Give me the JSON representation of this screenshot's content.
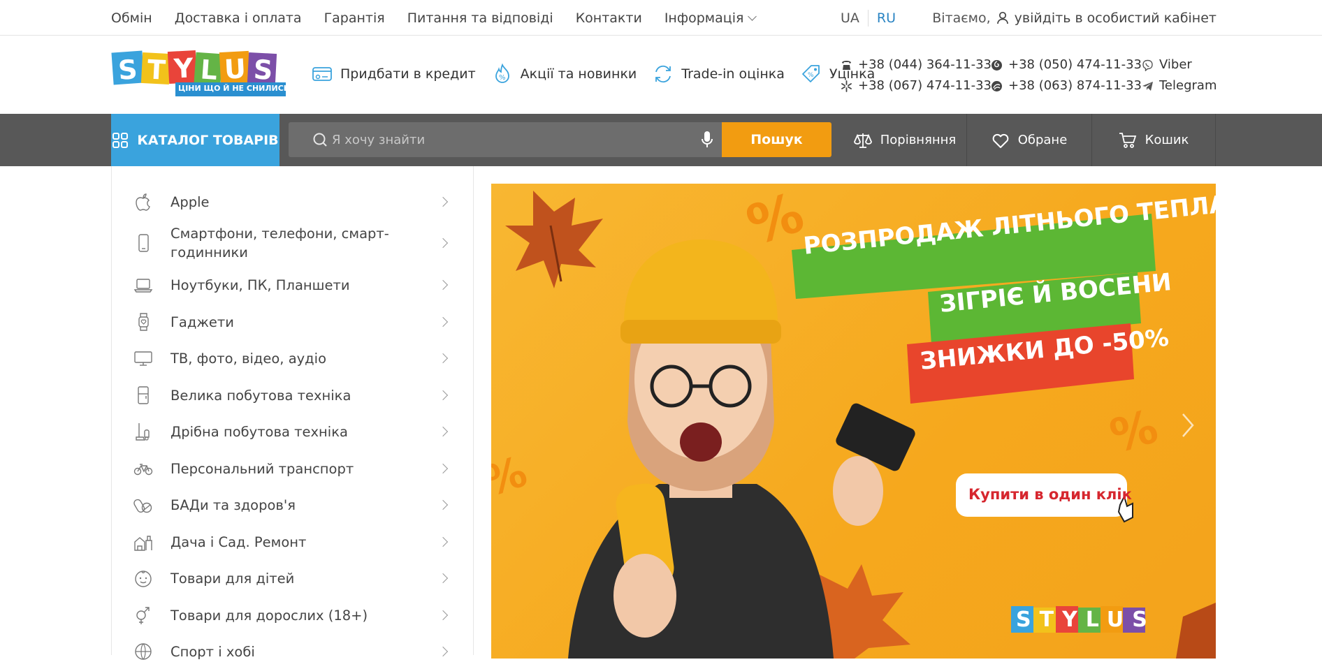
{
  "top_nav": {
    "links": [
      "Обмін",
      "Доставка і оплата",
      "Гарантія",
      "Питання та відповіді",
      "Контакти",
      "Інформація"
    ]
  },
  "languages": {
    "ua": "UA",
    "ru": "RU",
    "active": "UA"
  },
  "account": {
    "greeting": "Вітаємо,",
    "login_link": "увійдіть в особистий кабінет"
  },
  "logo": {
    "text": "STYLUS",
    "slogan": "ЦІНИ ЩО Й НЕ СНИЛИСЬ"
  },
  "promos": [
    {
      "label": "Придбати в кредит",
      "icon": "credit-card-icon"
    },
    {
      "label": "Акції та новинки",
      "icon": "fire-percent-icon"
    },
    {
      "label": "Trade-in оцінка",
      "icon": "exchange-icon"
    },
    {
      "label": "Уцінка",
      "icon": "price-tag-icon"
    }
  ],
  "phones": [
    {
      "number": "+38 (044) 364-11-33",
      "icon": "phone-icon"
    },
    {
      "number": "+38 (067) 474-11-33",
      "icon": "kyivstar-icon"
    },
    {
      "number": "+38 (050) 474-11-33",
      "icon": "vodafone-icon"
    },
    {
      "number": "+38 (063) 874-11-33",
      "icon": "lifecell-icon"
    }
  ],
  "messengers": [
    {
      "label": "Viber",
      "icon": "viber-icon"
    },
    {
      "label": "Telegram",
      "icon": "telegram-icon"
    }
  ],
  "toolbar": {
    "catalog_label": "КАТАЛОГ ТОВАРІВ",
    "search_placeholder": "Я хочу знайти",
    "search_button": "Пошук",
    "compare_label": "Порівняння",
    "favorites_label": "Обране",
    "cart_label": "Кошик"
  },
  "categories": [
    {
      "label": "Apple",
      "icon": "apple-icon"
    },
    {
      "label": "Смартфони, телефони, смарт-годинники",
      "icon": "smartphone-icon"
    },
    {
      "label": "Ноутбуки, ПК, Планшети",
      "icon": "laptop-icon"
    },
    {
      "label": "Гаджети",
      "icon": "smartwatch-icon"
    },
    {
      "label": "ТВ, фото, відео, аудіо",
      "icon": "tv-icon"
    },
    {
      "label": "Велика побутова техніка",
      "icon": "fridge-icon"
    },
    {
      "label": "Дрібна побутова техніка",
      "icon": "vacuum-icon"
    },
    {
      "label": "Персональний транспорт",
      "icon": "bicycle-icon"
    },
    {
      "label": "БАДи та здоров'я",
      "icon": "pills-icon"
    },
    {
      "label": "Дача і Сад. Ремонт",
      "icon": "garden-icon"
    },
    {
      "label": "Товари для дітей",
      "icon": "baby-icon"
    },
    {
      "label": "Товари для дорослих (18+)",
      "icon": "gender-icon"
    },
    {
      "label": "Спорт і хобі",
      "icon": "ball-icon"
    }
  ],
  "banner": {
    "line1": "РОЗПРОДАЖ ЛІТНЬОГО ТЕПЛА",
    "line2": "ЗІГРІЄ Й ВОСЕНИ",
    "line3": "ЗНИЖКИ ДО -50%",
    "cta": "Купити в один клік",
    "brand": "STYLUS",
    "colors": {
      "background": "#f6a81d",
      "green": "#5cb734",
      "red": "#e8452c",
      "cta_text": "#d6262e"
    }
  },
  "colors": {
    "accent_blue": "#3aa3dd",
    "search_orange": "#f29c11",
    "nav_dark": "#585858"
  }
}
